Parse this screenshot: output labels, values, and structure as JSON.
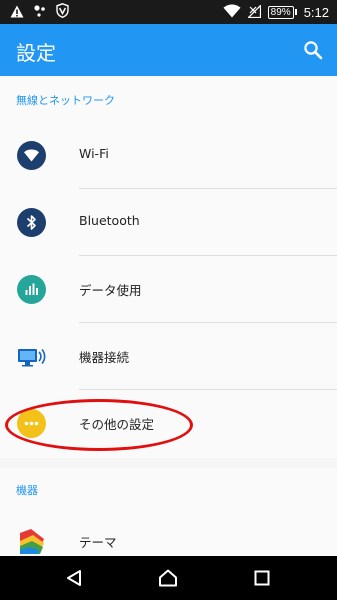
{
  "status_bar": {
    "battery": "89%",
    "time": "5:12"
  },
  "app_bar": {
    "title": "設定"
  },
  "sections": {
    "network": {
      "header": "無線とネットワーク",
      "items": [
        {
          "label": "Wi-Fi",
          "icon": "wifi-icon"
        },
        {
          "label": "Bluetooth",
          "icon": "bluetooth-icon"
        },
        {
          "label": "データ使用",
          "icon": "data-usage-icon"
        },
        {
          "label": "機器接続",
          "icon": "device-connection-icon"
        },
        {
          "label": "その他の設定",
          "icon": "more-icon"
        }
      ]
    },
    "device": {
      "header": "機器",
      "items": [
        {
          "label": "テーマ",
          "icon": "theme-icon"
        }
      ]
    }
  },
  "colors": {
    "accent": "#2196f3",
    "wifi": "#1c3f6e",
    "bluetooth": "#1c3f6e",
    "data_usage": "#26a69a",
    "more": "#f2c21b",
    "annotation": "#e01010"
  }
}
